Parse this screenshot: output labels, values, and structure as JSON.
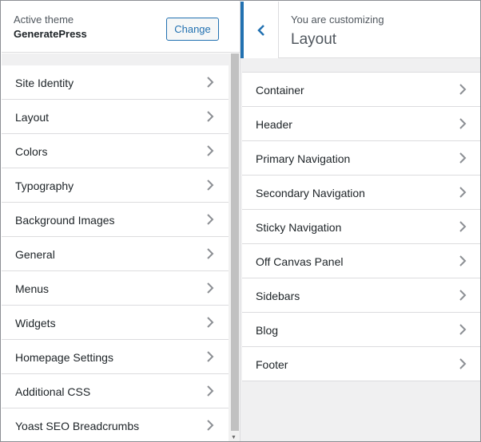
{
  "active_theme": {
    "label": "Active theme",
    "name": "GeneratePress",
    "change_label": "Change"
  },
  "sections": [
    {
      "label": "Site Identity"
    },
    {
      "label": "Layout"
    },
    {
      "label": "Colors"
    },
    {
      "label": "Typography"
    },
    {
      "label": "Background Images"
    },
    {
      "label": "General"
    },
    {
      "label": "Menus"
    },
    {
      "label": "Widgets"
    },
    {
      "label": "Homepage Settings"
    },
    {
      "label": "Additional CSS"
    },
    {
      "label": "Yoast SEO Breadcrumbs"
    }
  ],
  "customizing": {
    "label": "You are customizing",
    "title": "Layout"
  },
  "layout_sections": [
    {
      "label": "Container"
    },
    {
      "label": "Header"
    },
    {
      "label": "Primary Navigation"
    },
    {
      "label": "Secondary Navigation"
    },
    {
      "label": "Sticky Navigation"
    },
    {
      "label": "Off Canvas Panel"
    },
    {
      "label": "Sidebars"
    },
    {
      "label": "Blog"
    },
    {
      "label": "Footer"
    }
  ],
  "colors": {
    "accent": "#2271b1",
    "text": "#1d2327",
    "muted": "#50575e",
    "border": "#dcdcde",
    "panel_bg": "#f0f0f1"
  },
  "icons": {
    "chevron": "chevron-right-icon",
    "back": "chevron-left-icon"
  }
}
